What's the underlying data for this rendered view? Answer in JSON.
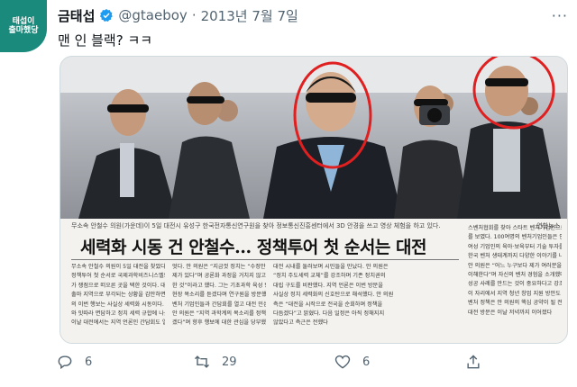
{
  "profile": {
    "avatar_text": "태섭이\n출마했당",
    "name": "금태섭",
    "handle": "@gtaeboy",
    "separator": "·",
    "date": "2013년 7월 7일",
    "more": "···"
  },
  "tweet": {
    "text": "맨 인 블랙? ㅋㅋ"
  },
  "article": {
    "caption": "무소속 안철수 의원(가운데)이 5일 대전시 유성구 한국전자통신연구원을 찾아 정보통신진흥센터에서 3D 안경을 쓰고 영상 체험을 하고 있다.",
    "credit": "연합뉴스",
    "headline": "세력화 시동 건 안철수… 정책투어 첫 순서는 대전",
    "col1": [
      "무소속 안철수 의원이 5일 대전을 찾았다. 지역",
      "정책투어 첫 순서로 국제과학비즈니스벨트 수정 문제",
      "가 쟁점으로 떠오른 곳을 택한 것이다. 대통령 지지",
      "출마 지역으로 부각되는 상황을 감안하면 안 의원",
      "의 이번 행보는 사실상 세력화 시동이다. 지역 인사",
      "와 잇따라 면담하고 정치 세력 규합에 나섰다",
      "이날 대전에서는 지역 언론인 간담회도 열었다"
    ],
    "col2": [
      "엇다. 안 의원은 “지금껏 정치는 “수정안에 두 가지 문",
      "제가 있다”며 공론화 과정을 거치지 않고 일방적으로",
      "한 것”이라고 했다. 그는 기초과학 육성 방안에 대해",
      "현장 목소리를 듣겠다며 연구원을 방문했다. 이어",
      "벤처 기업인들과 간담회를 열고 대전 민심을 살폈다",
      "안 의원은 “지역 과학계의 목소리를 정책에 반영하",
      "겠다”며 향후 행보에 대한 관심을 당부했다"
    ],
    "col3": [
      "대전 시내를 둘러보며 시민들을 만났다. 안 의원은",
      "“정치 주도세력 교체”를 강조하며 기존 정치권의",
      "대립 구도를 비판했다. 지역 언론은 이번 방문을",
      "사실상 정치 세력화의 신호탄으로 해석했다. 안 의원",
      "측은 “대전을 시작으로 전국을 순회하며 정책을",
      "다듬겠다”고 밝혔다. 다음 일정은 아직 정해지지",
      "않았다고 측근은 전했다"
    ],
    "col4": [
      "스벤처협회를 찾아 스타트 벤처기업인으로서의 면모",
      "를 보였다. 100여명의 벤처기업인들은 안 의원에게",
      "여성 기업인의 육아·보육부터 기술 투자를 키우는",
      "한국 벤처 생태계까지 다양한 이야기를 나눴다",
      "안 의원은 “어느 누구보다 제가 여러분을 잘",
      "이해한다”며 자신의 벤처 경험을 소개했다. 그는",
      "성공 사례를 만드는 것이 중요하다고 강조했다",
      "이 자리에서 지역 청년 창업 지원 방안도 논의됐다",
      "벤처 정책은 안 의원의 핵심 공약이 될 전망이다",
      "대전 방문은 이날 저녁까지 이어졌다"
    ]
  },
  "actions": {
    "reply_count": "6",
    "retweet_count": "29",
    "like_count": "6"
  },
  "colors": {
    "brand_teal": "#1a8a7c",
    "verified_blue": "#1d9bf0",
    "muted": "#536471",
    "highlight_red": "#e02020"
  }
}
